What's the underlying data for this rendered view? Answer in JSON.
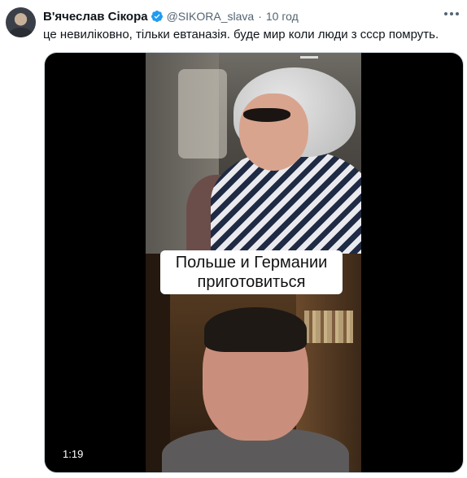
{
  "tweet": {
    "author_name": "В'ячеслав Сікора",
    "handle": "@SIKORA_slava",
    "separator": "·",
    "time": "10 год",
    "text": "це невиліковно, тільки евтаназія. буде мир коли люди з ссср помруть.",
    "verified": true,
    "icons": {
      "avatar": "user-avatar",
      "verified": "verified-badge-icon",
      "more": "more-options-icon"
    }
  },
  "media": {
    "caption_line1": "Польше и Германии",
    "caption_line2": "приготовиться",
    "duration": "1:19"
  },
  "colors": {
    "verified": "#1d9bf0",
    "text": "#0f1419",
    "secondary": "#536471"
  }
}
